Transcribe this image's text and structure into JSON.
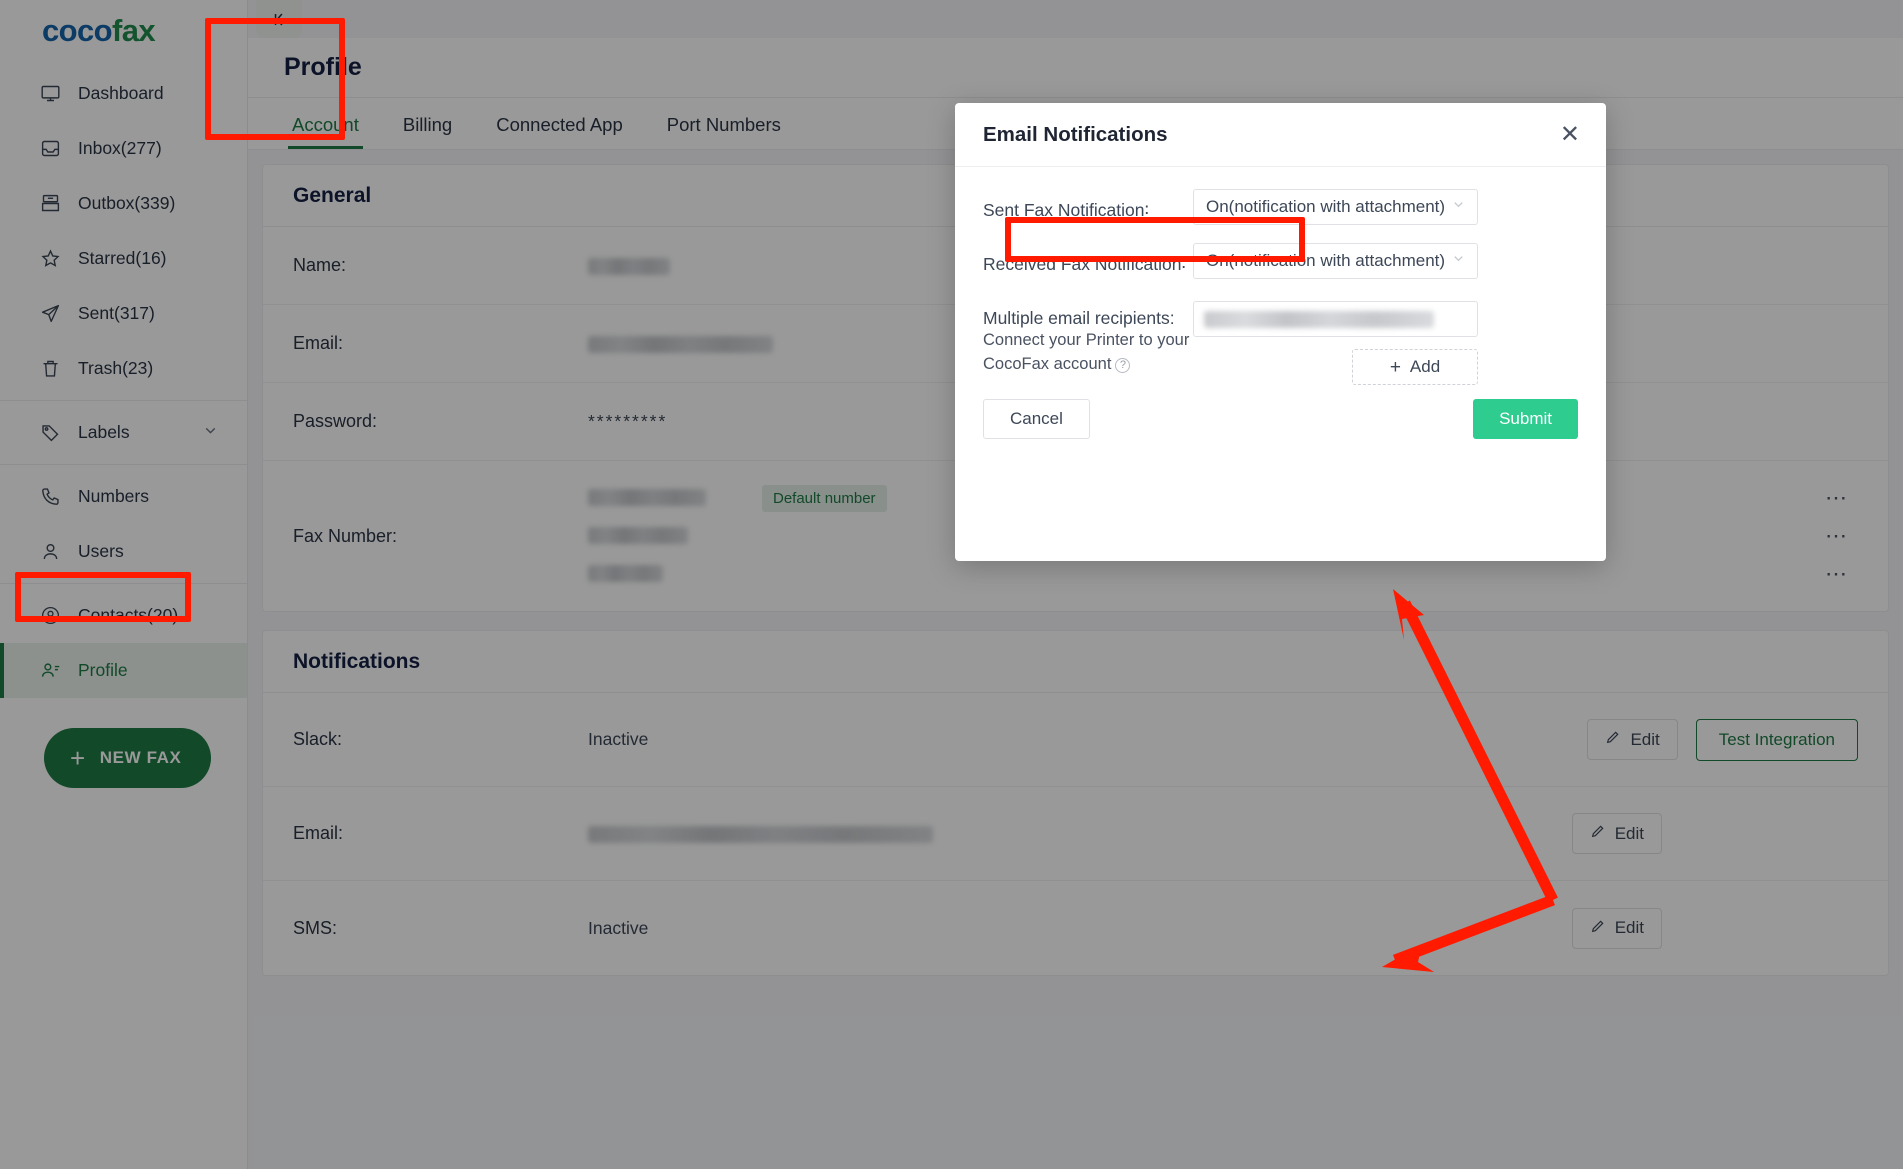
{
  "brand": {
    "part1": "coco",
    "part2": "fax",
    "blue": "#1565a8",
    "green": "#208b4c"
  },
  "accent_green": "#1f7a45",
  "annotation_red": "#ff1a00",
  "sidebar": {
    "groups": [
      {
        "items": [
          {
            "icon": "monitor-icon",
            "label": "Dashboard",
            "key": "dashboard"
          },
          {
            "icon": "inbox-icon",
            "label": "Inbox(277)",
            "key": "inbox"
          },
          {
            "icon": "outbox-icon",
            "label": "Outbox(339)",
            "key": "outbox"
          },
          {
            "icon": "star-icon",
            "label": "Starred(16)",
            "key": "starred"
          },
          {
            "icon": "send-icon",
            "label": "Sent(317)",
            "key": "sent"
          },
          {
            "icon": "trash-icon",
            "label": "Trash(23)",
            "key": "trash"
          }
        ]
      },
      {
        "items": [
          {
            "icon": "tag-icon",
            "label": "Labels",
            "key": "labels",
            "expandable": true
          }
        ]
      },
      {
        "items": [
          {
            "icon": "phone-icon",
            "label": "Numbers",
            "key": "numbers"
          },
          {
            "icon": "user-icon",
            "label": "Users",
            "key": "users"
          }
        ]
      },
      {
        "items": [
          {
            "icon": "contacts-icon",
            "label": "Contacts(20)",
            "key": "contacts"
          },
          {
            "icon": "profile-icon",
            "label": "Profile",
            "key": "profile",
            "active": true
          }
        ]
      }
    ],
    "new_fax_button": "NEW FAX"
  },
  "header": {
    "collapse_icon": "chevron-collapse-left-icon",
    "title": "Profile",
    "tabs": [
      {
        "label": "Account",
        "active": true
      },
      {
        "label": "Billing",
        "active": false
      },
      {
        "label": "Connected App",
        "active": false
      },
      {
        "label": "Port Numbers",
        "active": false
      }
    ]
  },
  "general": {
    "title": "General",
    "rows": [
      {
        "label": "Name:",
        "value": "",
        "redacted": true
      },
      {
        "label": "Email:",
        "value": "",
        "redacted": true
      },
      {
        "label": "Password:",
        "value": "*********",
        "redacted": false
      }
    ],
    "fax": {
      "label": "Fax Number:",
      "default_badge": "Default number",
      "menu_icon": "ellipsis-icon",
      "entries": [
        {
          "redacted": true,
          "default": true
        },
        {
          "redacted": true,
          "default": false
        },
        {
          "redacted": true,
          "default": false
        }
      ]
    }
  },
  "notifications": {
    "title": "Notifications",
    "edit_label": "Edit",
    "edit_icon": "pencil-icon",
    "test_integration_label": "Test Integration",
    "rows": [
      {
        "label": "Slack:",
        "value": "Inactive",
        "redacted": false,
        "has_test": true
      },
      {
        "label": "Email:",
        "value": "",
        "redacted": true,
        "has_test": false
      },
      {
        "label": "SMS:",
        "value": "Inactive",
        "redacted": false,
        "has_test": false
      }
    ]
  },
  "modal": {
    "title": "Email Notifications",
    "close_icon": "close-icon",
    "chevron_icon": "chevron-down-icon",
    "sent_label": "Sent Fax Notification∶",
    "sent_value": "On(notification with attachment)",
    "received_label": "Received Fax Notification∶",
    "received_value": "On(notification with attachment)",
    "recipients_label": "Multiple email recipients:",
    "recipients_hint_line1": "Connect your Printer to your",
    "recipients_hint_line2": "CocoFax account",
    "recipients_value": "",
    "help_icon": "question-mark-icon",
    "add_label": "Add",
    "add_icon": "plus-icon",
    "cancel_label": "Cancel",
    "submit_label": "Submit"
  },
  "annotations": {
    "boxes": [
      {
        "name": "profile-title-highlight"
      },
      {
        "name": "sidebar-profile-highlight"
      },
      {
        "name": "received-fax-select-highlight"
      }
    ],
    "arrow": {
      "name": "double-arrow-pointer",
      "color": "#ff1a00"
    }
  }
}
